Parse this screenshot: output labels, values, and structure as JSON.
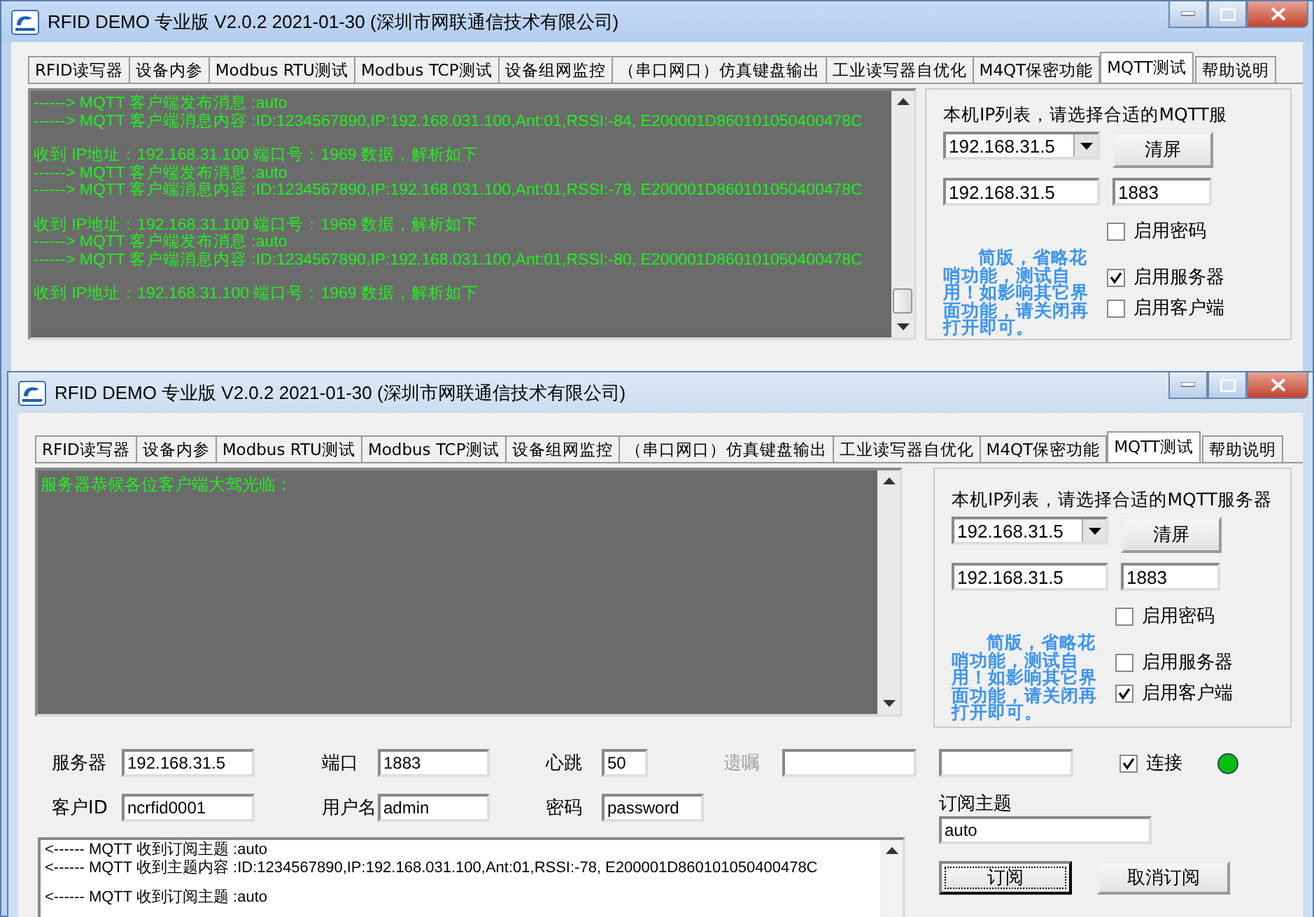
{
  "windows": [
    {
      "title": "RFID DEMO 专业版 V2.0.2  2021-01-30 (深圳市网联通信技术有限公司)",
      "active": true,
      "tabs": [
        {
          "label": "RFID读写器",
          "selected": false
        },
        {
          "label": "设备内参",
          "selected": false
        },
        {
          "label": "Modbus RTU测试",
          "selected": false
        },
        {
          "label": "Modbus TCP测试",
          "selected": false
        },
        {
          "label": "设备组网监控",
          "selected": false
        },
        {
          "label": "（串口网口）仿真键盘输出",
          "selected": false
        },
        {
          "label": "工业读写器自优化",
          "selected": false
        },
        {
          "label": "M4QT保密功能",
          "selected": false
        },
        {
          "label": "MQTT测试",
          "selected": true
        },
        {
          "label": "帮助说明",
          "selected": false
        }
      ],
      "log": {
        "groups": [
          {
            "lines": [
              "------>  MQTT 客户端发布消息 :auto",
              "------>  MQTT 客户端消息内容 :ID:1234567890,IP:192.168.031.100,Ant:01,RSSI:-84, E200001D860101050400478C"
            ]
          },
          {
            "lines": [
              "收到 IP地址：192.168.31.100  端口号：1969 数据，解析如下",
              "------>  MQTT 客户端发布消息 :auto",
              "------>  MQTT 客户端消息内容 :ID:1234567890,IP:192.168.031.100,Ant:01,RSSI:-78, E200001D860101050400478C"
            ]
          },
          {
            "lines": [
              "收到 IP地址：192.168.31.100  端口号：1969 数据，解析如下",
              "------>  MQTT 客户端发布消息 :auto",
              "------>  MQTT 客户端消息内容 :ID:1234567890,IP:192.168.031.100,Ant:01,RSSI:-80, E200001D860101050400478C"
            ]
          },
          {
            "lines": [
              "收到 IP地址：192.168.31.100  端口号：1969 数据，解析如下"
            ]
          }
        ]
      },
      "panel": {
        "ip_list_label": "本机IP列表，请选择合适的MQTT服",
        "ip_select": "192.168.31.5",
        "clear_button": "清屏",
        "ip_input": "192.168.31.5",
        "port_input": "1883",
        "note": "简版，省略花哨功能，测试自用！如影响其它界面功能，请关闭再打开即可。",
        "options": [
          {
            "label": "启用密码",
            "checked": false
          },
          {
            "label": "启用服务器",
            "checked": true
          },
          {
            "label": "启用客户端",
            "checked": false
          }
        ]
      }
    },
    {
      "title": "RFID DEMO 专业版 V2.0.2  2021-01-30 (深圳市网联通信技术有限公司)",
      "active": false,
      "tabs": [
        {
          "label": "RFID读写器",
          "selected": false
        },
        {
          "label": "设备内参",
          "selected": false
        },
        {
          "label": "Modbus RTU测试",
          "selected": false
        },
        {
          "label": "Modbus TCP测试",
          "selected": false
        },
        {
          "label": "设备组网监控",
          "selected": false
        },
        {
          "label": "（串口网口）仿真键盘输出",
          "selected": false
        },
        {
          "label": "工业读写器自优化",
          "selected": false
        },
        {
          "label": "M4QT保密功能",
          "selected": false
        },
        {
          "label": "MQTT测试",
          "selected": true
        },
        {
          "label": "帮助说明",
          "selected": false
        }
      ],
      "log": {
        "groups": [
          {
            "lines": [
              "服务器恭候各位客户端大驾光临："
            ]
          }
        ]
      },
      "panel": {
        "ip_list_label": "本机IP列表，请选择合适的MQTT服务器",
        "ip_select": "192.168.31.5",
        "clear_button": "清屏",
        "ip_input": "192.168.31.5",
        "port_input": "1883",
        "note": "简版，省略花哨功能，测试自用！如影响其它界面功能，请关闭再打开即可。",
        "options": [
          {
            "label": "启用密码",
            "checked": false
          },
          {
            "label": "启用服务器",
            "checked": false
          },
          {
            "label": "启用客户端",
            "checked": true
          }
        ]
      },
      "client": {
        "rows": [
          {
            "fields": [
              {
                "label": "服务器",
                "value": "192.168.31.5",
                "disabled": false
              },
              {
                "label": "端口",
                "value": "1883",
                "disabled": false
              },
              {
                "label": "心跳",
                "value": "50",
                "disabled": false
              },
              {
                "label": "遗嘱",
                "disabled": true
              }
            ]
          },
          {
            "fields": [
              {
                "label": "客户ID",
                "value": "ncrfid0001",
                "disabled": false
              },
              {
                "label": "用户名",
                "value": "admin",
                "disabled": false
              },
              {
                "label": "密码",
                "value": "password",
                "disabled": false
              }
            ]
          }
        ],
        "connect": {
          "label": "连接",
          "checked": true
        },
        "online": true,
        "topic": {
          "label": "订阅主题",
          "value": "auto"
        },
        "buttons": [
          {
            "label": "订阅",
            "focused": true
          },
          {
            "label": "取消订阅",
            "focused": false
          }
        ],
        "messages": {
          "groups": [
            {
              "lines": [
                "<------  MQTT 收到订阅主题 :auto",
                "<------  MQTT 收到主题内容 :ID:1234567890,IP:192.168.031.100,Ant:01,RSSI:-78, E200001D860101050400478C"
              ]
            },
            {
              "lines": [
                "<------  MQTT 收到订阅主题 :auto"
              ]
            }
          ]
        }
      }
    }
  ]
}
